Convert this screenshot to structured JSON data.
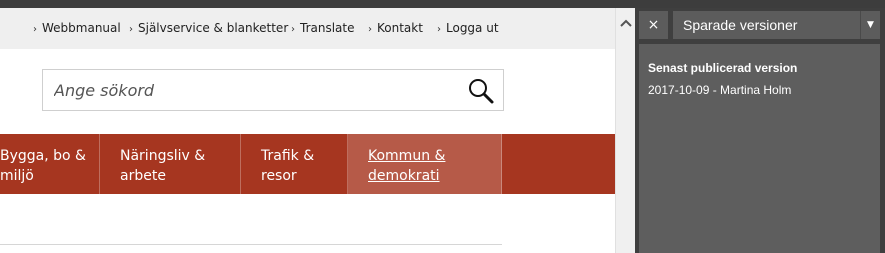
{
  "top_nav": {
    "items": [
      {
        "label": "Webbmanual"
      },
      {
        "label": "Självservice & blanketter"
      },
      {
        "label": "Translate"
      },
      {
        "label": "Kontakt"
      },
      {
        "label": "Logga ut"
      }
    ]
  },
  "search": {
    "placeholder": "Ange sökord",
    "icon": "search-icon"
  },
  "main_nav": {
    "items": [
      {
        "label": "Bygga, bo &\nmiljö",
        "active": false
      },
      {
        "label": "Näringsliv &\narbete",
        "active": false
      },
      {
        "label": "Trafik &\nresor",
        "active": false
      },
      {
        "label": "Kommun &\ndemokrati",
        "active": true
      }
    ]
  },
  "panel": {
    "close_label": "×",
    "select_value": "Sparade versioner",
    "info_title": "Senast publicerad version",
    "info_detail": "2017-10-09 - Martina Holm"
  },
  "colors": {
    "nav_bg": "#a63620",
    "nav_active_bg": "#b65a48",
    "panel_bg": "#3f3f3f",
    "panel_card_bg": "#5e5e5e"
  }
}
